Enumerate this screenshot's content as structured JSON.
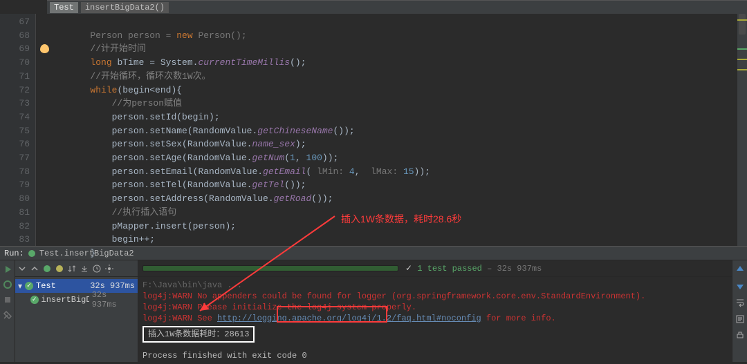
{
  "breadcrumb": {
    "t1": "Test",
    "t2": "insertBigData2()"
  },
  "lines": {
    "start": 67,
    "end": 83
  },
  "code": {
    "l67": "Person person = new Person();",
    "l68": "//计开始时间",
    "l69a": "long",
    "l69b": " bTime = System.",
    "l69c": "currentTimeMillis",
    "l69d": "();",
    "l70": "//开始循环，循环次数1W次。",
    "l71a": "while",
    "l71b": "(begin<end){",
    "l72": "//为person赋值",
    "l73": "person.setId(begin);",
    "l74a": "person.setName(RandomValue.",
    "l74b": "getChineseName",
    "l74c": "());",
    "l75a": "person.setSex(RandomValue.",
    "l75b": "name_sex",
    "l75c": ");",
    "l76a": "person.setAge(RandomValue.",
    "l76b": "getNum",
    "l76c": "(",
    "l76d": "1",
    "l76e": ", ",
    "l76f": "100",
    "l76g": "));",
    "l77a": "person.setEmail(RandomValue.",
    "l77b": "getEmail",
    "l77c": "(",
    "l77d": " lMin: ",
    "l77e": "4",
    "l77f": ", ",
    "l77g": " lMax: ",
    "l77h": "15",
    "l77i": "));",
    "l78a": "person.setTel(RandomValue.",
    "l78b": "getTel",
    "l78c": "());",
    "l79a": "person.setAddress(RandomValue.",
    "l79b": "getRoad",
    "l79c": "());",
    "l80": "//执行插入语句",
    "l81": "pMapper.insert(person);",
    "l82": "begin++;",
    "l83": "}"
  },
  "run": {
    "title": "Run:",
    "tab": "Test.insertBigData2",
    "tree": {
      "root": "Test",
      "rootTime": "32s 937ms",
      "child": "insertBigD",
      "childTime": "32s 937ms"
    },
    "progress": {
      "passed": "1 test passed",
      "dash": " – ",
      "time": "32s 937ms"
    },
    "console": {
      "path": "F:\\Java\\bin\\java ...",
      "w1a": "log4j:WARN No appenders could be found for logger (org.springframework.core.env.StandardEnvironment).",
      "w2": "log4j:WARN Please initialize the log4j system properly.",
      "w3a": "log4j:WARN See ",
      "w3b": "http://logging.apache.org/log4j/1.2/faq.html#noconfig",
      "w3c": " for more info.",
      "boxed": "插入1W条数据耗时：28613",
      "exit": "Process finished with exit code 0"
    }
  },
  "annotation": "插入1W条数据，耗时28.6秒"
}
